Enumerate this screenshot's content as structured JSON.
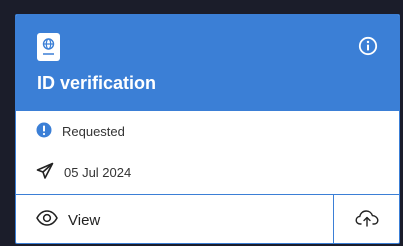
{
  "card": {
    "title": "ID verification",
    "header_color": "#3b7fd6",
    "icons": {
      "document": "passport-icon",
      "info": "info-icon"
    }
  },
  "status": {
    "label": "Requested",
    "icon": "info-filled-icon",
    "color": "#3b7fd6"
  },
  "sent": {
    "date": "05 Jul 2024",
    "icon": "paper-plane-icon"
  },
  "actions": {
    "view_label": "View",
    "view_icon": "eye-icon",
    "upload_icon": "cloud-upload-icon"
  }
}
